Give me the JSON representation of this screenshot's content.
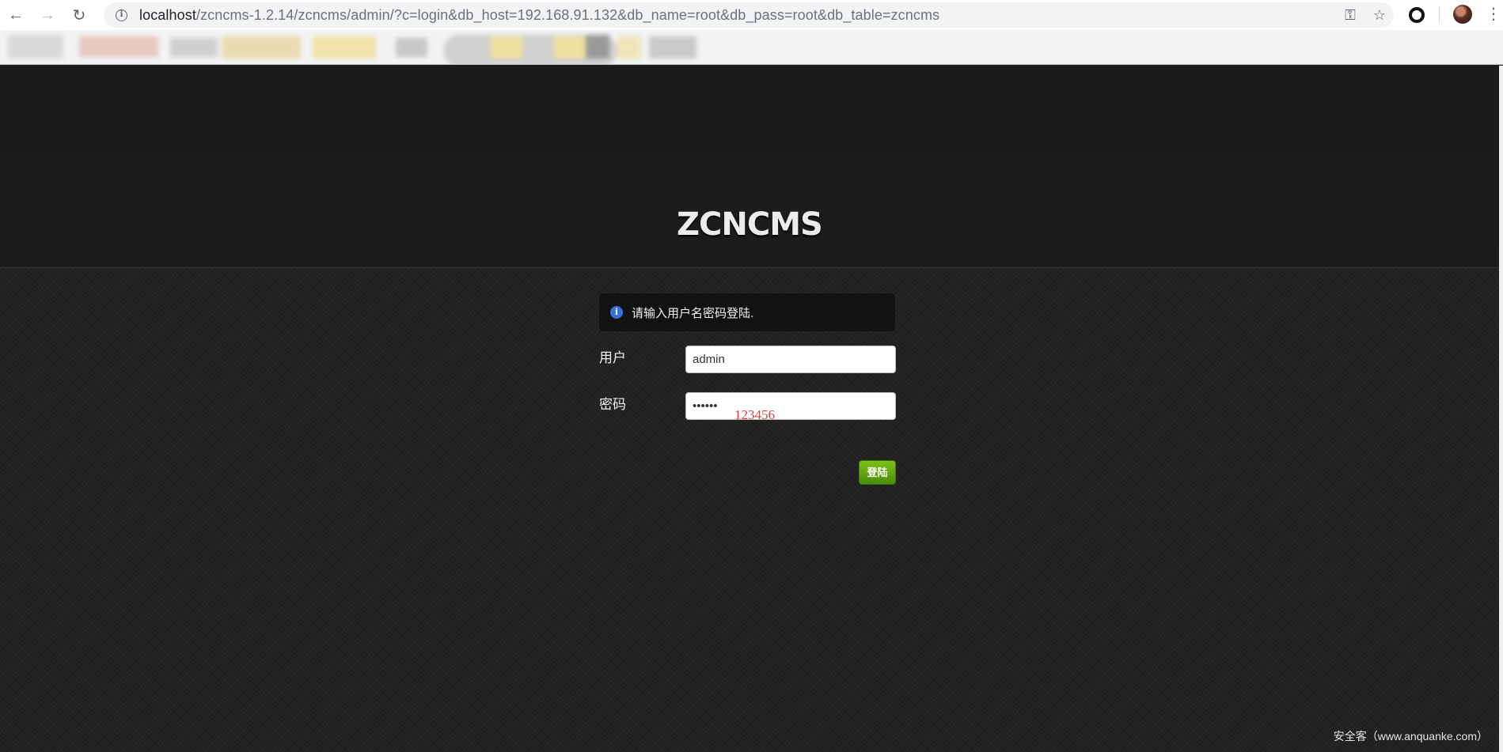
{
  "browser": {
    "url_host": "localhost",
    "url_path": "/zcncms-1.2.14/zcncms/admin/?c=login&db_host=192.168.91.132&db_name=root&db_pass=root&db_table=zcncms",
    "icons": {
      "back": "arrow-left-icon",
      "forward": "arrow-right-icon",
      "reload": "reload-icon",
      "site_info": "info-icon",
      "key": "key-icon",
      "bookmark": "star-icon",
      "extension": "ring-icon",
      "profile": "avatar",
      "menu": "kebab-menu-icon"
    }
  },
  "page": {
    "logo_text": "ZCNCMS",
    "notice": "请输入用户名密码登陆.",
    "username_label": "用户",
    "username_value": "admin",
    "password_label": "密码",
    "password_value": "123456",
    "password_overlay": "123456",
    "login_button": "登陆",
    "watermark": "安全客（www.anquanke.com）"
  },
  "colors": {
    "page_bg": "#1f1f1f",
    "button_green": "#5aa312",
    "notice_icon": "#3b6fe0",
    "overlay_red": "#e04040"
  }
}
